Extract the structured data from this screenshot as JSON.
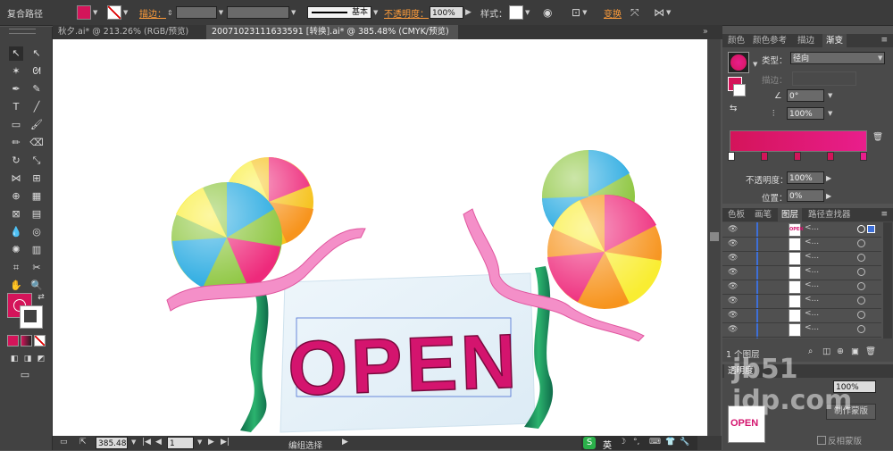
{
  "control_bar": {
    "object_type": "复合路径",
    "stroke_label": "描边：",
    "stroke_style": "基本",
    "opacity_label": "不透明度：",
    "opacity_value": "100%",
    "style_label": "样式：",
    "transform_label": "变换",
    "fill_color": "#d4145a"
  },
  "document_tabs": [
    {
      "label": "秋夕.ai* @ 213.26% (RGB/预览)",
      "active": false
    },
    {
      "label": "20071023111633591 [转换].ai* @ 385.48% (CMYK/预览)",
      "active": true
    }
  ],
  "status_bar": {
    "zoom": "385.48",
    "page": "1",
    "status_text": "编组选择"
  },
  "artwork": {
    "sign_text": "OPEN"
  },
  "gradient_panel": {
    "tabs": [
      "颜色",
      "颜色参考",
      "描边",
      "渐变"
    ],
    "type_label": "类型：",
    "type_value": "径向",
    "stroke_label": "描边：",
    "angle_value": "0°",
    "ratio_value": "100%",
    "opacity_label": "不透明度：",
    "opacity_value": "100%",
    "location_label": "位置：",
    "location_value": "0%",
    "gradient_start": "#d4145a",
    "gradient_end": "#e91e8c"
  },
  "layers_panel": {
    "tabs": [
      "色板",
      "画笔",
      "图层",
      "路径查找器"
    ],
    "rows": [
      "<...",
      "<...",
      "<...",
      "<...",
      "<...",
      "<...",
      "<...",
      "<..."
    ],
    "footer_text": "1 个图层"
  },
  "transparency_panel": {
    "tab_label": "透明度",
    "opacity_value": "100%",
    "make_mask_button": "制作蒙版",
    "invert_mask_label": "反相蒙版",
    "thumb_text": "OPEN"
  },
  "watermark": {
    "text": "jb51 idp.com"
  }
}
